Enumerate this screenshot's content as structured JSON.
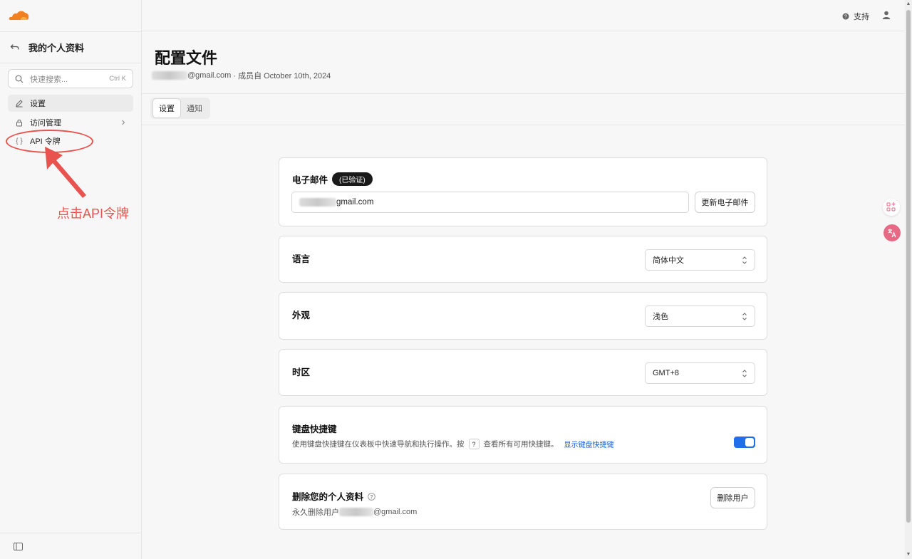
{
  "brand": {
    "accent": "#f38020"
  },
  "sidebar": {
    "back_icon": "back-arrow-icon",
    "title": "我的个人资料",
    "search": {
      "placeholder": "快速搜索...",
      "shortcut": "Ctrl K"
    },
    "items": [
      {
        "label": "设置",
        "icon": "pencil-icon",
        "active": true
      },
      {
        "label": "访问管理",
        "icon": "lock-icon",
        "has_chevron": true
      },
      {
        "label": "API 令牌",
        "icon": "braces-icon"
      }
    ],
    "annotation": {
      "text": "点击API令牌",
      "color": "#e8534f"
    }
  },
  "topbar": {
    "support_label": "支持"
  },
  "page": {
    "title": "配置文件",
    "subtitle_email_suffix": "@gmail.com",
    "subtitle_rest": " · 成员自 October 10th, 2024",
    "tabs": [
      {
        "label": "设置",
        "active": true
      },
      {
        "label": "通知",
        "active": false
      }
    ]
  },
  "cards": {
    "email": {
      "title": "电子邮件",
      "badge": "(已验证)",
      "value_suffix": "gmail.com",
      "button": "更新电子邮件"
    },
    "language": {
      "title": "语言",
      "value": "简体中文"
    },
    "appearance": {
      "title": "外观",
      "value": "浅色"
    },
    "timezone": {
      "title": "时区",
      "value": "GMT+8"
    },
    "shortcuts": {
      "title": "键盘快捷键",
      "desc_before": "使用键盘快捷键在仪表板中快速导航和执行操作。按",
      "key": "?",
      "desc_after": "查看所有可用快捷键。",
      "link": "显示键盘快捷键",
      "enabled": true
    },
    "delete": {
      "title": "删除您的个人资料",
      "desc_prefix": "永久删除用户",
      "desc_suffix": "@gmail.com",
      "button": "删除用户"
    }
  }
}
